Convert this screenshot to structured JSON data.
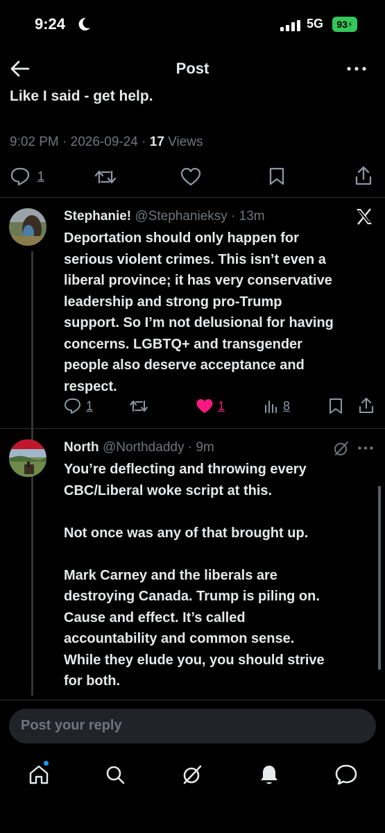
{
  "status": {
    "time": "9:24",
    "network": "5G",
    "battery": "93"
  },
  "header": {
    "title": "Post"
  },
  "main_post": {
    "text": "Like I said - get help.",
    "time": "9:02 PM",
    "date": "2026-09-24",
    "views_count": "17",
    "views_label": "Views",
    "replies": "1"
  },
  "replies": [
    {
      "name": "Stephanie!",
      "handle": "@Stephanieksy",
      "time": "13m",
      "lines": [
        "Deportation should only happen for",
        "serious violent crimes. This isn’t even a",
        "liberal province; it has very conservative",
        "leadership and strong pro-Trump",
        "support. So I’m not delusional for having",
        "concerns. LGBTQ+ and transgender",
        "people also deserve acceptance and",
        "respect."
      ],
      "stats": {
        "replies": "1",
        "likes": "1",
        "views": "8"
      }
    },
    {
      "name": "North",
      "handle": "@Northdaddy",
      "time": "9m",
      "lines": [
        "You’re deflecting and throwing every",
        "CBC/Liberal woke script at this.",
        "",
        "Not once was any of that brought up.",
        "",
        "Mark Carney and the liberals are",
        "destroying Canada.  Trump is piling on.",
        "Cause and effect.  It’s called",
        "accountability and common sense.",
        "While they elude you, you should strive",
        "for both."
      ]
    }
  ],
  "composer": {
    "placeholder": "Post your reply"
  },
  "colors": {
    "like": "#f91880",
    "accent": "#1d9bf0",
    "battery": "#34c759"
  }
}
